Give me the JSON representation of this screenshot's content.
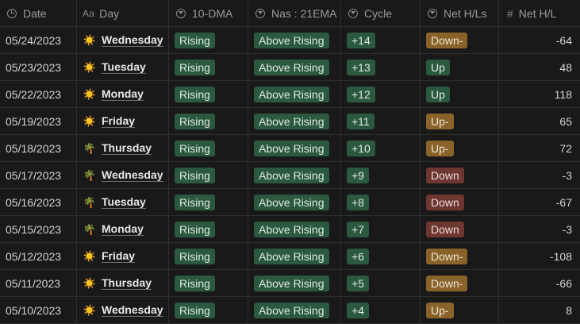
{
  "headers": {
    "date": "Date",
    "day_icon_text": "Aa",
    "day": "Day",
    "dma": "10-DMA",
    "nas": "Nas : 21EMA",
    "cycle": "Cycle",
    "net_hls": "Net H/Ls",
    "net_hl": "Net H/L"
  },
  "colors": {
    "green_tag": "#2b593f",
    "brown_tag": "#89632a",
    "red_tag": "#6e3630",
    "background": "#191919"
  },
  "rows": [
    {
      "date": "05/24/2023",
      "day_icon": "sun-icon",
      "day_glyph": "☀️",
      "day": "Wednesday",
      "dma": "Rising",
      "nas": "Above Rising",
      "cycle": "+14",
      "net_hls": "Down-",
      "net_hls_color": "brown",
      "net_hl": "-64"
    },
    {
      "date": "05/23/2023",
      "day_icon": "sun-icon",
      "day_glyph": "☀️",
      "day": "Tuesday",
      "dma": "Rising",
      "nas": "Above Rising",
      "cycle": "+13",
      "net_hls": "Up",
      "net_hls_color": "green",
      "net_hl": "48"
    },
    {
      "date": "05/22/2023",
      "day_icon": "sun-icon",
      "day_glyph": "☀️",
      "day": "Monday",
      "dma": "Rising",
      "nas": "Above Rising",
      "cycle": "+12",
      "net_hls": "Up",
      "net_hls_color": "green",
      "net_hl": "118"
    },
    {
      "date": "05/19/2023",
      "day_icon": "sun-icon",
      "day_glyph": "☀️",
      "day": "Friday",
      "dma": "Rising",
      "nas": "Above Rising",
      "cycle": "+11",
      "net_hls": "Up-",
      "net_hls_color": "brown",
      "net_hl": "65"
    },
    {
      "date": "05/18/2023",
      "day_icon": "palm-tree-icon",
      "day_glyph": "🌴",
      "day": "Thursday",
      "dma": "Rising",
      "nas": "Above Rising",
      "cycle": "+10",
      "net_hls": "Up-",
      "net_hls_color": "brown",
      "net_hl": "72"
    },
    {
      "date": "05/17/2023",
      "day_icon": "palm-tree-icon",
      "day_glyph": "🌴",
      "day": "Wednesday",
      "dma": "Rising",
      "nas": "Above Rising",
      "cycle": "+9",
      "net_hls": "Down",
      "net_hls_color": "red",
      "net_hl": "-3"
    },
    {
      "date": "05/16/2023",
      "day_icon": "palm-tree-icon",
      "day_glyph": "🌴",
      "day": "Tuesday",
      "dma": "Rising",
      "nas": "Above Rising",
      "cycle": "+8",
      "net_hls": "Down",
      "net_hls_color": "red",
      "net_hl": "-67"
    },
    {
      "date": "05/15/2023",
      "day_icon": "palm-tree-icon",
      "day_glyph": "🌴",
      "day": "Monday",
      "dma": "Rising",
      "nas": "Above Rising",
      "cycle": "+7",
      "net_hls": "Down",
      "net_hls_color": "red",
      "net_hl": "-3"
    },
    {
      "date": "05/12/2023",
      "day_icon": "sun-icon",
      "day_glyph": "☀️",
      "day": "Friday",
      "dma": "Rising",
      "nas": "Above Rising",
      "cycle": "+6",
      "net_hls": "Down-",
      "net_hls_color": "brown",
      "net_hl": "-108"
    },
    {
      "date": "05/11/2023",
      "day_icon": "sun-icon",
      "day_glyph": "☀️",
      "day": "Thursday",
      "dma": "Rising",
      "nas": "Above Rising",
      "cycle": "+5",
      "net_hls": "Down-",
      "net_hls_color": "brown",
      "net_hl": "-66"
    },
    {
      "date": "05/10/2023",
      "day_icon": "sun-icon",
      "day_glyph": "☀️",
      "day": "Wednesday",
      "dma": "Rising",
      "nas": "Above Rising",
      "cycle": "+4",
      "net_hls": "Up-",
      "net_hls_color": "brown",
      "net_hl": "8"
    }
  ]
}
